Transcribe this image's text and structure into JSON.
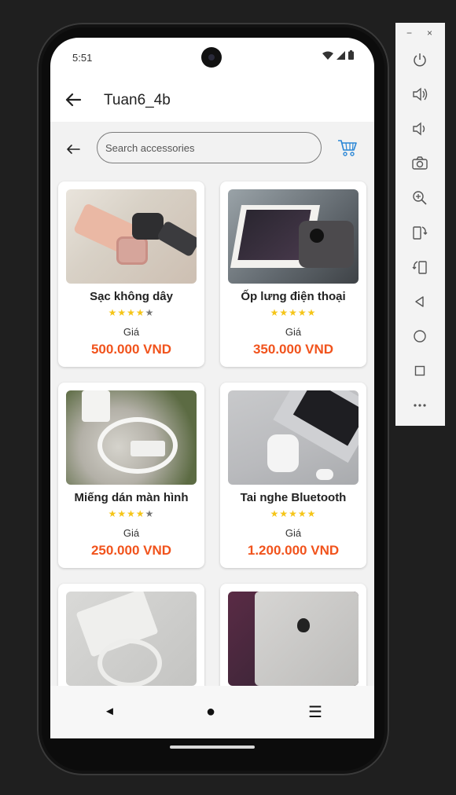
{
  "status_bar": {
    "time": "5:51"
  },
  "app_bar": {
    "title": "Tuan6_4b"
  },
  "search": {
    "placeholder": "Search accessories",
    "value": ""
  },
  "products": [
    {
      "name": "Sạc không dây",
      "rating": 4,
      "price_label": "Giá",
      "price": "500.000 VND"
    },
    {
      "name": "Ốp lưng điện thoại",
      "rating": 5,
      "price_label": "Giá",
      "price": "350.000 VND"
    },
    {
      "name": "Miếng dán màn hình",
      "rating": 4,
      "price_label": "Giá",
      "price": "250.000 VND"
    },
    {
      "name": "Tai nghe Bluetooth",
      "rating": 5,
      "price_label": "Giá",
      "price": "1.200.000 VND"
    },
    {
      "name": "",
      "rating": null,
      "price_label": "",
      "price": ""
    },
    {
      "name": "",
      "rating": null,
      "price_label": "",
      "price": ""
    }
  ],
  "nav_bar": {
    "back": "◄",
    "home": "●",
    "recents": "☰"
  },
  "emulator_panel": {
    "window_controls": [
      "−",
      "×"
    ],
    "buttons": [
      "power-icon",
      "volume-up-icon",
      "volume-down-icon",
      "camera-icon",
      "zoom-icon",
      "rotate-left-icon",
      "rotate-right-icon",
      "back-icon",
      "home-icon",
      "overview-icon",
      "more-icon"
    ]
  },
  "colors": {
    "price": "#f1531c",
    "star": "#f5c518",
    "background": "#f2f2f2"
  }
}
